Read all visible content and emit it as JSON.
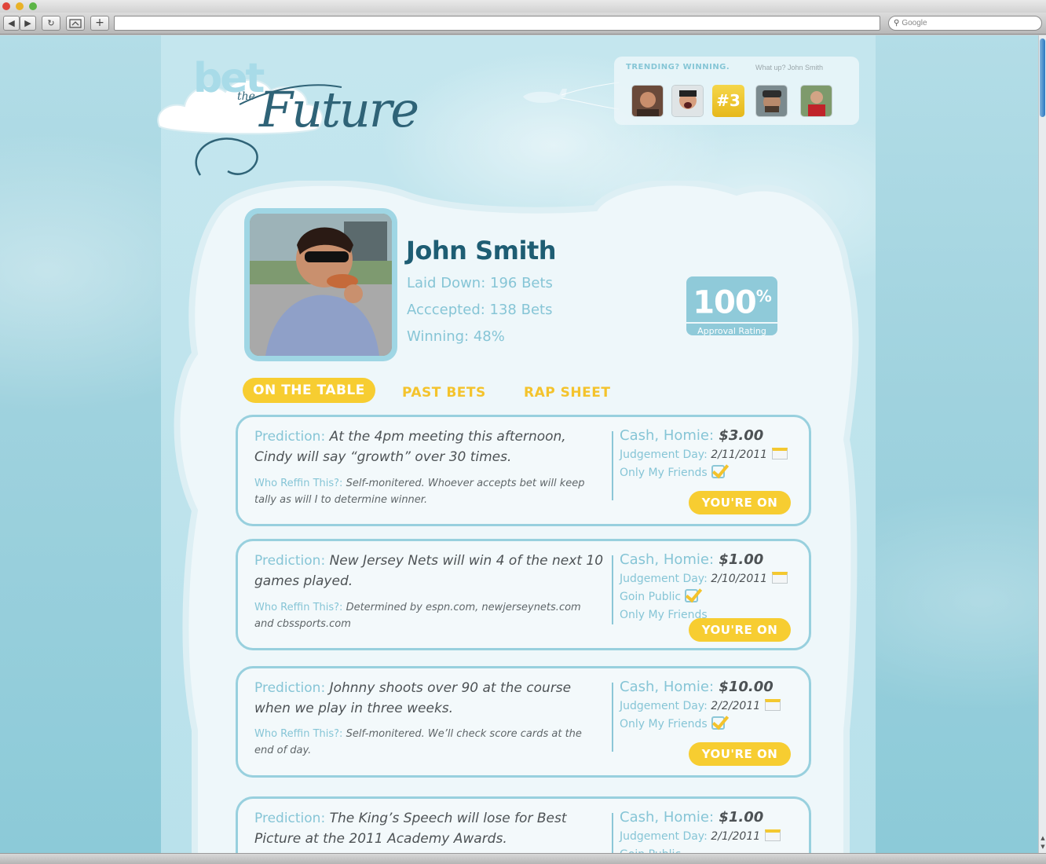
{
  "browser": {
    "search_placeholder": "Google",
    "back": "◀",
    "forward": "▶",
    "reload": "↻",
    "add_tab": "+"
  },
  "logo": {
    "bet": "bet",
    "the": "the",
    "future": "Future"
  },
  "trending": {
    "title": "TRENDING? WINNING.",
    "whatup": "What up? John Smith",
    "rank": "#3"
  },
  "profile": {
    "name": "John Smith",
    "laid_down": "Laid Down: 196 Bets",
    "accepted": "Acccepted: 138 Bets",
    "winning": "Winning: 48%",
    "approval_value": "100",
    "approval_unit": "%",
    "approval_label": "Approval Rating"
  },
  "tabs": [
    {
      "label": "ON THE TABLE"
    },
    {
      "label": "PAST BETS"
    },
    {
      "label": "RAP SHEET"
    }
  ],
  "labels": {
    "prediction": "Prediction:",
    "who_reffin": "Who Reffin This?:",
    "cash": "Cash, Homie:",
    "judgement": "Judgement Day:",
    "accept_button": "YOU'RE ON"
  },
  "bets": [
    {
      "prediction": "At the 4pm meeting this afternoon, Cindy will say “growth” over 30 times.",
      "ref": "Self-monitered. Whoever accepts bet will keep tally as will I to determine winner.",
      "cash": "$3.00",
      "date": "2/11/2011",
      "opt1": "Only My Friends",
      "opt2": ""
    },
    {
      "prediction": "New Jersey Nets will win 4 of the next 10 games played.",
      "ref": "Determined by espn.com, newjerseynets.com and cbssports.com",
      "cash": "$1.00",
      "date": "2/10/2011",
      "opt1": "Goin Public",
      "opt2": "Only My Friends"
    },
    {
      "prediction": "Johnny shoots over 90 at the course when we play in three weeks.",
      "ref": "Self-monitered. We’ll check score cards at the end of day.",
      "cash": "$10.00",
      "date": "2/2/2011",
      "opt1": "Only My Friends",
      "opt2": ""
    },
    {
      "prediction": "The King’s Speech will lose for Best Picture at the 2011 Academy Awards.",
      "ref": "",
      "cash": "$1.00",
      "date": "2/1/2011",
      "opt1": "Goin Public",
      "opt2": ""
    }
  ],
  "colors": {
    "accent_yellow": "#f7cd31",
    "accent_blue": "#86c5d6",
    "dark_teal": "#1e5d73"
  }
}
